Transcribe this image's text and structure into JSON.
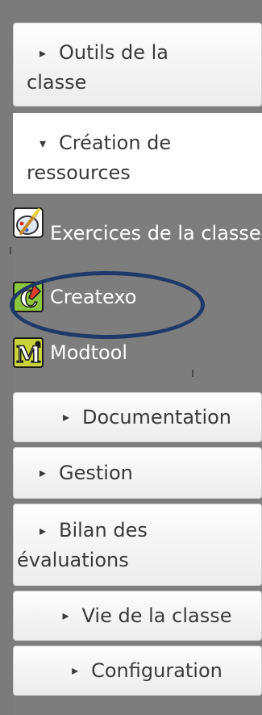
{
  "menu": {
    "sections_top": [
      {
        "label_line1": "Outils de la",
        "label_line2": "classe",
        "expanded": false
      },
      {
        "label_line1": "Création de",
        "label_line2": "ressources",
        "expanded": true
      }
    ],
    "sub_items": [
      {
        "label": "Exercices de la classe",
        "icon": "palette-brush-icon"
      },
      {
        "label": "Createxo",
        "icon": "createxo-c-icon"
      },
      {
        "label": "Modtool",
        "icon": "modtool-m-icon"
      }
    ],
    "sections_bottom": [
      {
        "label": "Documentation"
      },
      {
        "label": "Gestion"
      },
      {
        "label_line1": "Bilan des",
        "label_line2": "évaluations"
      },
      {
        "label": "Vie de la classe"
      },
      {
        "label": "Configuration"
      }
    ],
    "caret_collapsed": "▸",
    "caret_expanded": "▾",
    "highlight_color": "#1f3a68"
  }
}
